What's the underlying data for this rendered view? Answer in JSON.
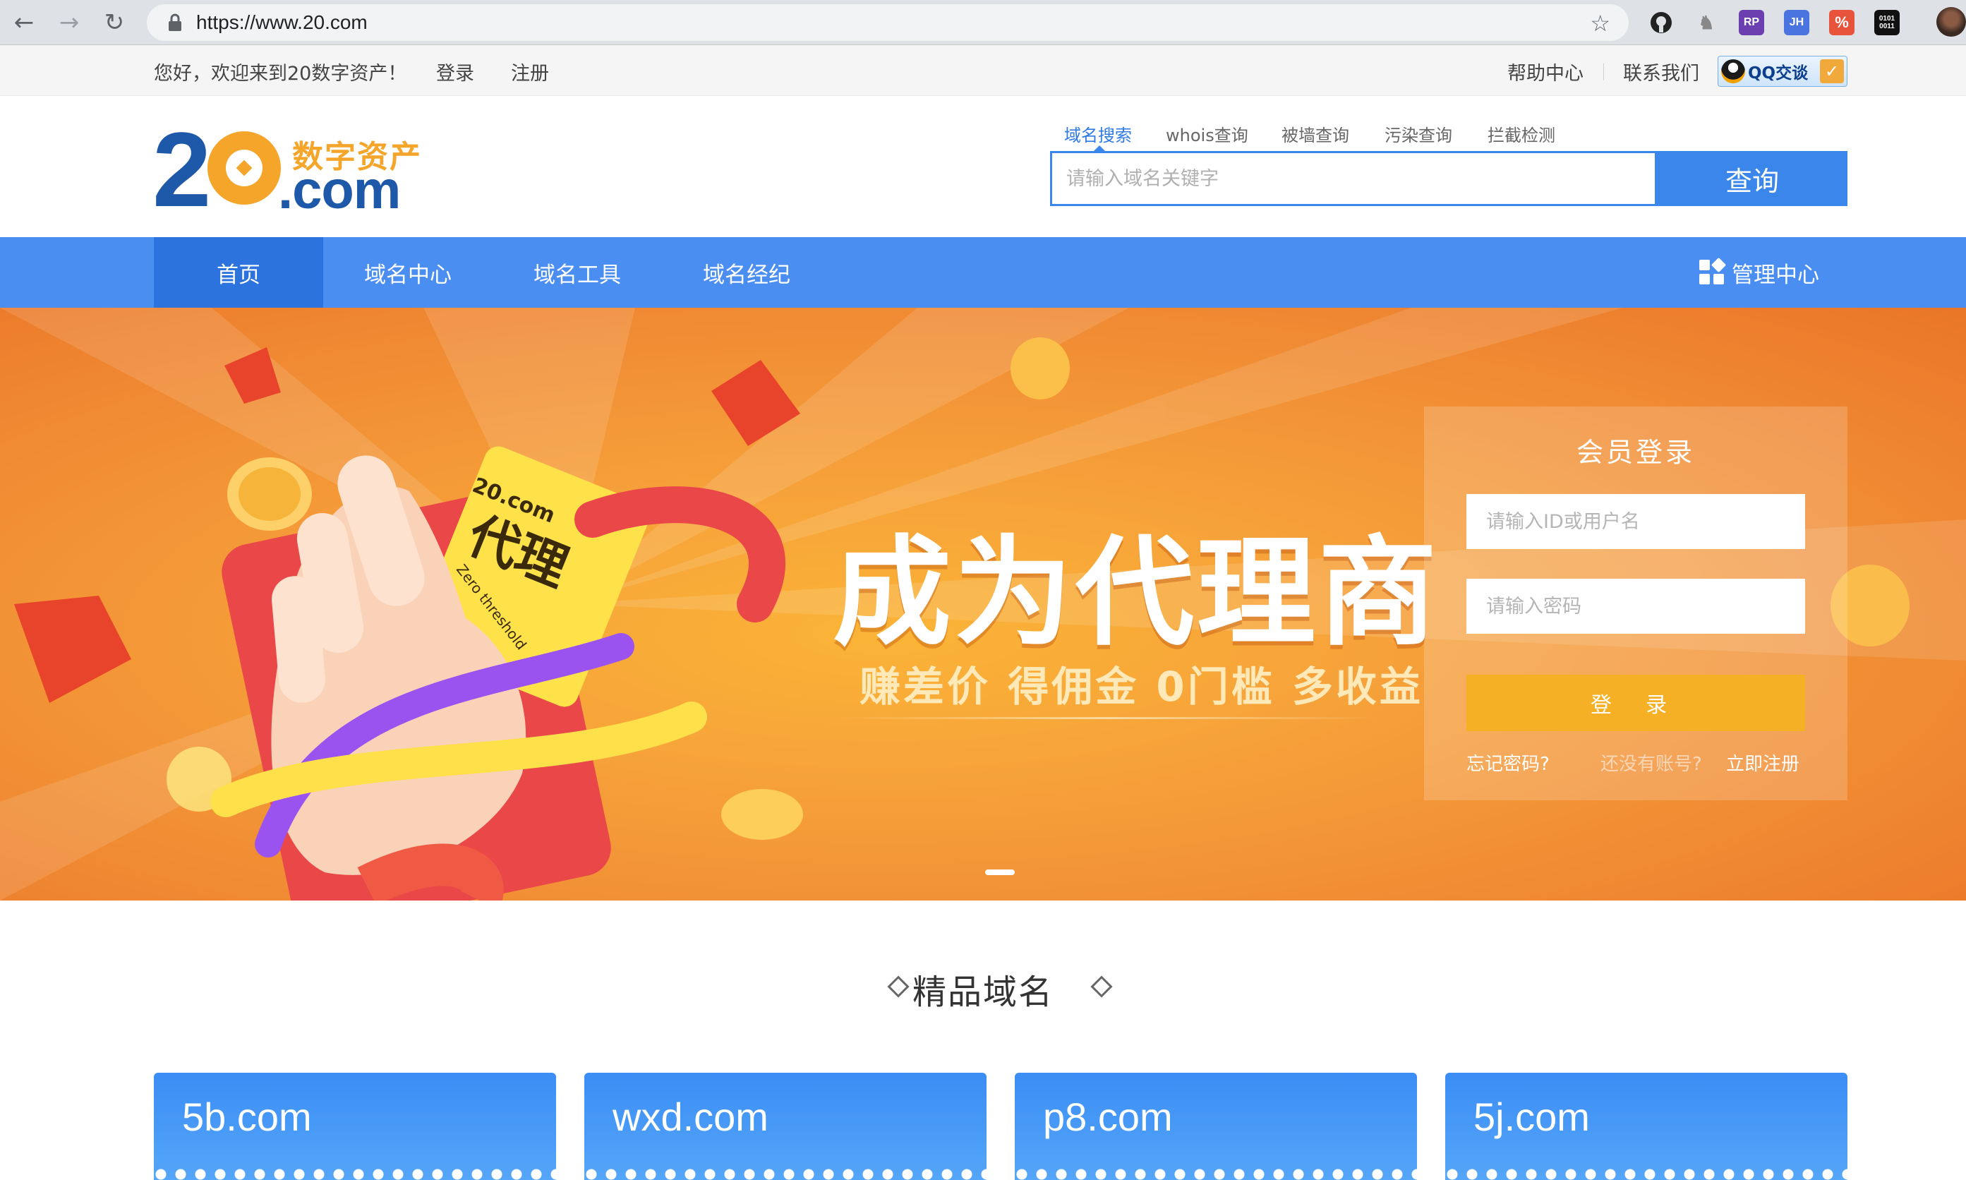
{
  "browser": {
    "url": "https://www.20.com",
    "extensions": [
      "github-icon",
      "tree-icon",
      "rp-icon",
      "jh-icon",
      "translate-icon",
      "binary-icon"
    ],
    "ext_labels": {
      "rp": "RP",
      "jh": "JH",
      "binary": "0101 0011"
    }
  },
  "topbar": {
    "greeting": "您好，欢迎来到20数字资产！",
    "login": "登录",
    "register": "注册",
    "help": "帮助中心",
    "contact": "联系我们",
    "qq": "QQ交谈"
  },
  "logo": {
    "number": "20",
    "cn": "数字资产",
    "suffix": ".com"
  },
  "search": {
    "tabs": [
      "域名搜索",
      "whois查询",
      "被墙查询",
      "污染查询",
      "拦截检测"
    ],
    "active_tab": "域名搜索",
    "placeholder": "请输入域名关键字",
    "button": "查询"
  },
  "nav": {
    "items": [
      "首页",
      "域名中心",
      "域名工具",
      "域名经纪"
    ],
    "active": "首页",
    "management": "管理中心"
  },
  "banner": {
    "title": "成为代理商",
    "subtitle": "赚差价 得佣金 0门槛 多收益",
    "card_text": "代理",
    "card_sub": "Zero threshold",
    "card_logo": "20.com",
    "slides": 1,
    "active_slide": 1
  },
  "login": {
    "title": "会员登录",
    "username_placeholder": "请输入ID或用户名",
    "password_placeholder": "请输入密码",
    "button": "登 录",
    "forgot": "忘记密码?",
    "no_account": "还没有账号?",
    "register_now": "立即注册"
  },
  "section": {
    "title": "精品域名"
  },
  "domains": [
    "5b.com",
    "wxd.com",
    "p8.com",
    "5j.com"
  ],
  "colors": {
    "primary": "#3a86ea",
    "nav": "#4b8ef1",
    "nav_active": "#2c73dd",
    "accent": "#f6b026",
    "logo_orange": "#f4a52a",
    "logo_blue": "#1e58a8"
  }
}
